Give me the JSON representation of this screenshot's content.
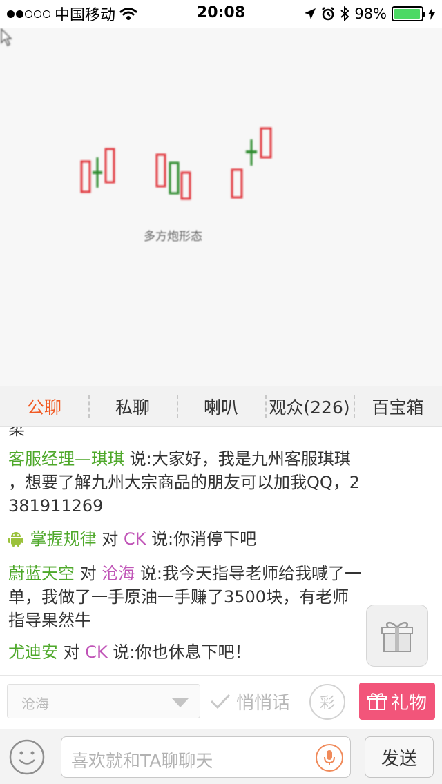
{
  "status_bar": {
    "carrier": "中国移动",
    "time": "20:08",
    "battery_percent": "98%",
    "battery_level": 0.98,
    "signal_bars": 2,
    "icons": [
      "wifi-icon",
      "location-arrow-icon",
      "alarm-icon",
      "bluetooth-icon",
      "battery-icon",
      "charging-icon"
    ]
  },
  "video": {
    "caption": "多方炮形态"
  },
  "tabs": [
    {
      "label": "公聊",
      "active": true
    },
    {
      "label": "私聊",
      "active": false
    },
    {
      "label": "喇叭",
      "active": false
    },
    {
      "label": "观众(226)",
      "active": false
    },
    {
      "label": "百宝箱",
      "active": false
    }
  ],
  "chat": {
    "partial_top": "柔",
    "messages": [
      {
        "sender": "客服经理—琪琪",
        "text_line1": "说:大家好，我是九州客服琪琪",
        "text_line2": "，想要了解九州大宗商品的朋友可以加我QQ，2",
        "text_line3": "381911269"
      },
      {
        "sender": "掌握规律",
        "connector": "对",
        "target": "CK",
        "text": "说:你消停下吧"
      },
      {
        "sender": "蔚蓝天空",
        "connector": "对",
        "target": "沧海",
        "text_line1": "说:我今天指导老师给我喊了一",
        "text_line2": "单，我做了一手原油一手赚了3500块，有老师",
        "text_line3": "指导果然牛"
      },
      {
        "sender": "尤迪安",
        "connector": "对",
        "target": "CK",
        "text": "说:你也休息下吧！"
      }
    ]
  },
  "actions": {
    "target_value": "沧海",
    "whisper_label": "悄悄话",
    "color_label": "彩",
    "gift_label": "礼物"
  },
  "input": {
    "placeholder": "喜欢就和TA聊聊天",
    "send_label": "发送"
  },
  "colors": {
    "accent_orange": "#f15a24",
    "nick_green": "#4ea82a",
    "nick_purple": "#c054b7",
    "gift_pink": "#f2557a",
    "battery_green": "#4cd964",
    "candle_red": "#e0393f",
    "candle_green": "#2e8b2e"
  }
}
